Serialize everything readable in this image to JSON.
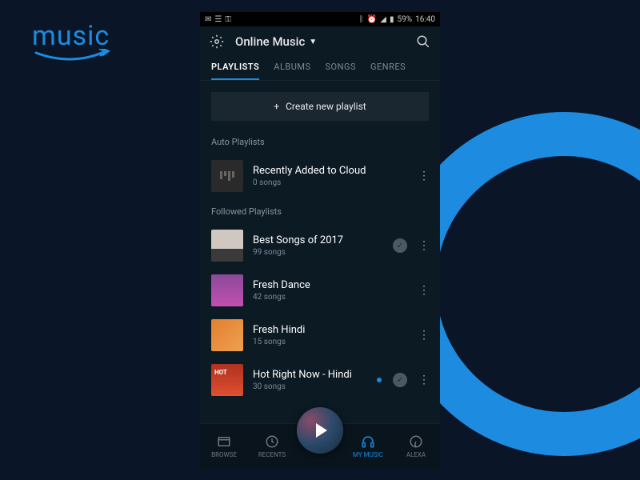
{
  "logo": {
    "text": "music"
  },
  "status": {
    "battery": "59%",
    "time": "16:40"
  },
  "header": {
    "title": "Online Music"
  },
  "tabs": [
    "PLAYLISTS",
    "ALBUMS",
    "SONGS",
    "GENRES"
  ],
  "activeTab": 0,
  "createBtn": "Create new playlist",
  "sections": {
    "auto": {
      "label": "Auto Playlists",
      "items": [
        {
          "title": "Recently Added to Cloud",
          "sub": "0 songs",
          "check": false,
          "dot": false
        }
      ]
    },
    "followed": {
      "label": "Followed Playlists",
      "items": [
        {
          "title": "Best Songs of 2017",
          "sub": "99 songs",
          "check": true,
          "dot": false
        },
        {
          "title": "Fresh Dance",
          "sub": "42 songs",
          "check": false,
          "dot": false
        },
        {
          "title": "Fresh Hindi",
          "sub": "15 songs",
          "check": false,
          "dot": false
        },
        {
          "title": "Hot Right Now - Hindi",
          "sub": "30 songs",
          "check": true,
          "dot": true
        }
      ]
    }
  },
  "bottomNav": [
    "BROWSE",
    "RECENTS",
    "",
    "MY MUSIC",
    "ALEXA"
  ],
  "activeNav": 3
}
